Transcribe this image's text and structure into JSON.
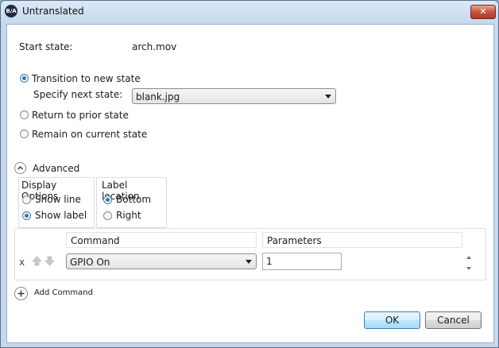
{
  "window": {
    "title": "Untranslated",
    "icon_text": "B/A",
    "close_symbol": "✕"
  },
  "start_state": {
    "label": "Start state:",
    "value": "arch.mov"
  },
  "transition": {
    "new_state_label": "Transition to new state",
    "next_state_label": "Specify next state:",
    "next_state_value": "blank.jpg",
    "prior_state_label": "Return to prior state",
    "remain_label": "Remain on current state",
    "selected": "new_state"
  },
  "advanced": {
    "label": "Advanced",
    "display_options": {
      "title": "Display Options",
      "show_line": "Show line",
      "show_label": "Show label",
      "selected": "show_label"
    },
    "label_location": {
      "title": "Label location",
      "bottom": "Bottom",
      "right": "Right",
      "selected": "bottom"
    }
  },
  "commands": {
    "headers": {
      "command": "Command",
      "parameters": "Parameters"
    },
    "rows": [
      {
        "remove": "x",
        "command": "GPIO On",
        "parameters": "1"
      }
    ],
    "add_label": "Add Command"
  },
  "buttons": {
    "ok": "OK",
    "cancel": "Cancel"
  },
  "colors": {
    "accent": "#2e79b9",
    "title_bar": "#c6d8ee",
    "close_button": "#c9533d"
  }
}
